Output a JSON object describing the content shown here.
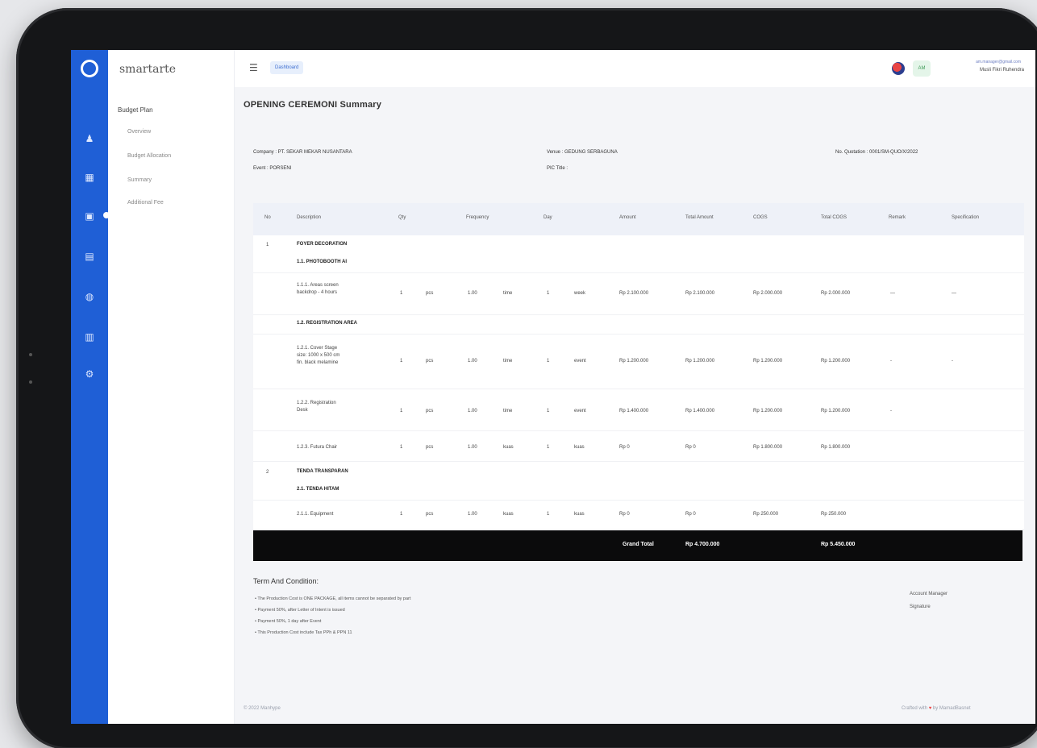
{
  "app": {
    "brand": "smartarte"
  },
  "nav": {
    "header": "Budget Plan",
    "items": [
      "Overview",
      "Budget Allocation",
      "Summary",
      "Additional Fee"
    ]
  },
  "topbar": {
    "breadcrumb": "Dashboard",
    "avatar_initials": "AM",
    "user_email": "am.manager@gmail.com",
    "user_name": "Musli Fikri Ruhendra"
  },
  "page": {
    "title": "OPENING CEREMONI Summary",
    "company": "Company : PT. SEKAR MEKAR NUSANTARA",
    "event": "Event : PORSENI",
    "venue": "Venue : GEDUNG SERBAGUNA",
    "pic": "PIC Title :",
    "quotation": "No. Quotation : 0001/SM-QUO/X/2022"
  },
  "table": {
    "headers": [
      "No",
      "Description",
      "Qty",
      "Frequency",
      "Day",
      "Amount",
      "Total Amount",
      "COGS",
      "Total COGS",
      "Remark",
      "Specification"
    ],
    "rows": [
      {
        "type": "group",
        "no": "1",
        "label": "FOYER DECORATION"
      },
      {
        "type": "sub",
        "label": "1.1. PHOTOBOOTH AI"
      },
      {
        "type": "item",
        "desc": [
          "1.1.1. Areas screen",
          "backdrop - 4 hours"
        ],
        "qty": "1",
        "unit": "pcs",
        "freq": "1.00",
        "freq_unit": "time",
        "day": "1",
        "day_unit": "week",
        "amount": "Rp 2.100.000",
        "total": "Rp 2.100.000",
        "cogs": "Rp 2.000.000",
        "tcogs": "Rp 2.000.000",
        "remark": "—",
        "spec": "—"
      },
      {
        "type": "sub",
        "label": "1.2. REGISTRATION AREA"
      },
      {
        "type": "item",
        "desc": [
          "1.2.1. Cover Stage",
          "size: 1000 x 500 cm",
          "fin. black melamine"
        ],
        "qty": "1",
        "unit": "pcs",
        "freq": "1.00",
        "freq_unit": "time",
        "day": "1",
        "day_unit": "event",
        "amount": "Rp 1.200.000",
        "total": "Rp 1.200.000",
        "cogs": "Rp 1.200.000",
        "tcogs": "Rp 1.200.000",
        "remark": "-",
        "spec": "-"
      },
      {
        "type": "item",
        "desc": [
          "1.2.2. Registration",
          "Desk"
        ],
        "qty": "1",
        "unit": "pcs",
        "freq": "1.00",
        "freq_unit": "time",
        "day": "1",
        "day_unit": "event",
        "amount": "Rp 1.400.000",
        "total": "Rp 1.400.000",
        "cogs": "Rp 1.200.000",
        "tcogs": "Rp 1.200.000",
        "remark": "-",
        "spec": "-"
      },
      {
        "type": "item",
        "desc": [
          "1.2.3. Futura Chair"
        ],
        "qty": "1",
        "unit": "pcs",
        "freq": "1.00",
        "freq_unit": "kuas",
        "day": "1",
        "day_unit": "kuas",
        "amount": "Rp 0",
        "total": "Rp 0",
        "cogs": "Rp 1.800.000",
        "tcogs": "Rp 1.800.000",
        "remark": "",
        "spec": ""
      },
      {
        "type": "group",
        "no": "2",
        "label": "TENDA TRANSPARAN"
      },
      {
        "type": "sub",
        "label": "2.1. TENDA HITAM"
      },
      {
        "type": "item",
        "desc": [
          "2.1.1. Equipment"
        ],
        "qty": "1",
        "unit": "pcs",
        "freq": "1.00",
        "freq_unit": "kuas",
        "day": "1",
        "day_unit": "kuas",
        "amount": "Rp 0",
        "total": "Rp 0",
        "cogs": "Rp 250.000",
        "tcogs": "Rp 250.000",
        "remark": "",
        "spec": ""
      }
    ]
  },
  "grand_total": {
    "label": "Grand Total",
    "total_amount": "Rp 4.700.000",
    "total_cogs": "Rp 5.450.000"
  },
  "terms": {
    "title": "Term And Condition:",
    "items": [
      "The Production Cost is ONE PACKAGE, all items cannot be separated by part",
      "Payment 50%, after Letter of Intent is issued",
      "Payment 50%, 1 day after Event",
      "This Production Cost include Tax PPh & PPN 11"
    ],
    "sign_role": "Account Manager",
    "sign_label": "Signature"
  },
  "footer": {
    "left": "© 2022 Manhype",
    "right_prefix": "Crafted with",
    "right_suffix": "by MamadBasnet"
  },
  "colors": {
    "accent": "#1f5fd6",
    "grand_bar": "#0b0b0c"
  }
}
